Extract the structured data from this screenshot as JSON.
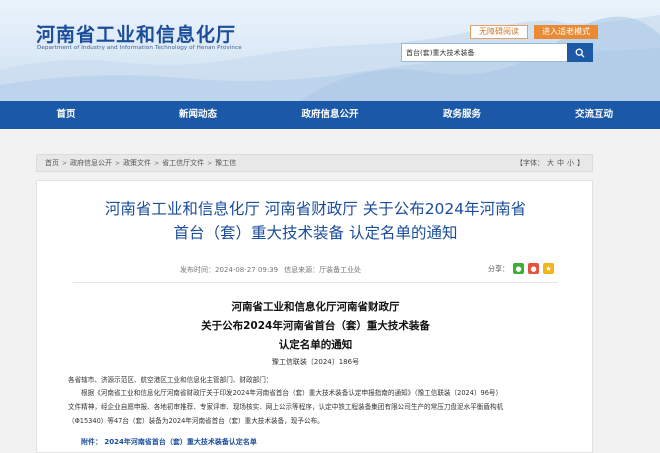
{
  "header": {
    "title": "河南省工业和信息化厅",
    "subtitle": "Department of Industry and Information Technology of Henan Province",
    "accessibility_label": "无障碍阅读",
    "elder_mode_label": "进入适老模式",
    "search_value": "首台(套)重大技术装备"
  },
  "nav": {
    "items": [
      "首页",
      "新闻动态",
      "政府信息公开",
      "政务服务",
      "交流互动"
    ]
  },
  "breadcrumb": {
    "items": [
      "首页",
      "政府信息公开",
      "政策文件",
      "省工信厅文件",
      "豫工信"
    ],
    "font_label": "【字体：",
    "font_large": "大",
    "font_medium": "中",
    "font_small": "小",
    "font_end": "】"
  },
  "article": {
    "title_line1": "河南省工业和信息化厅 河南省财政厅 关于公布2024年河南省",
    "title_line2": "首台（套）重大技术装备 认定名单的通知",
    "publish_label": "发布时间：",
    "publish_time": "2024-08-27 09:39",
    "source_label": "信息来源：",
    "source": "厅装备工业处",
    "share_label": "分享：",
    "doc_head_1": "河南省工业和信息化厅河南省财政厅",
    "doc_head_2": "关于公布2024年河南省首台（套）重大技术装备",
    "doc_head_3": "认定名单的通知",
    "doc_number": "豫工信联装〔2024〕186号",
    "recipients": "各省辖市、济源示范区、航空港区工业和信息化主管部门、财政部门：",
    "para_1": "根据《河南省工业和信息化厅河南省财政厅关于印发2024年河南省首台（套）重大技术装备认定申报指南的通知》（豫工信联装〔2024〕96号）",
    "para_2": "文件精神，经企业自愿申报、各地初审推荐、专家评审、现场核实、网上公示等程序，认定中铁工程装备集团有限公司生产的常压刀盘泥水平衡盾构机",
    "para_3": "（Φ15340）等47台（套）装备为2024年河南省首台（套）重大技术装备，现予公布。",
    "attachment": "附件： 2024年河南省首台（套）重大技术装备认定名单"
  },
  "colors": {
    "brand_blue": "#1b58a7",
    "title_blue": "#1b4d9b",
    "elder_orange": "#e98b35"
  },
  "icons": {
    "search": "search-icon",
    "wechat": "wechat-icon",
    "weibo": "weibo-icon",
    "qzone": "qzone-icon"
  }
}
